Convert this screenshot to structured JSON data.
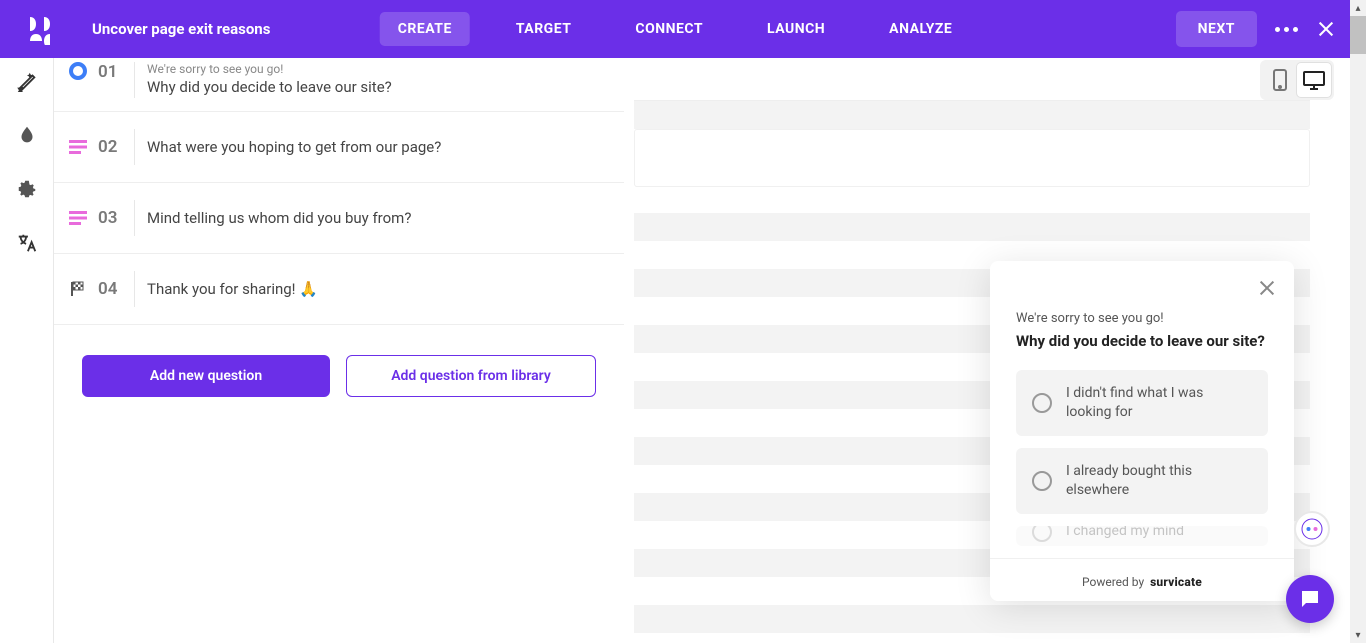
{
  "header": {
    "title": "Uncover page exit reasons",
    "nav": [
      "CREATE",
      "TARGET",
      "CONNECT",
      "LAUNCH",
      "ANALYZE"
    ],
    "active_nav": 0,
    "next_label": "NEXT"
  },
  "questions": [
    {
      "num": "01",
      "intro": "We're sorry to see you go!",
      "text": "Why did you decide to leave our site?",
      "icon": "single"
    },
    {
      "num": "02",
      "text": "What were you hoping to get from our page?",
      "icon": "text"
    },
    {
      "num": "03",
      "text": "Mind telling us whom did you buy from?",
      "icon": "text"
    },
    {
      "num": "04",
      "text": "Thank you for sharing! 🙏",
      "icon": "flag"
    }
  ],
  "buttons": {
    "add_new": "Add new question",
    "add_library": "Add question from library"
  },
  "widget": {
    "intro": "We're sorry to see you go!",
    "question": "Why did you decide to leave our site?",
    "options": [
      "I didn't find what I was looking for",
      "I already bought this elsewhere",
      "I changed my mind"
    ],
    "powered_prefix": "Powered by",
    "powered_brand": "survicate"
  }
}
